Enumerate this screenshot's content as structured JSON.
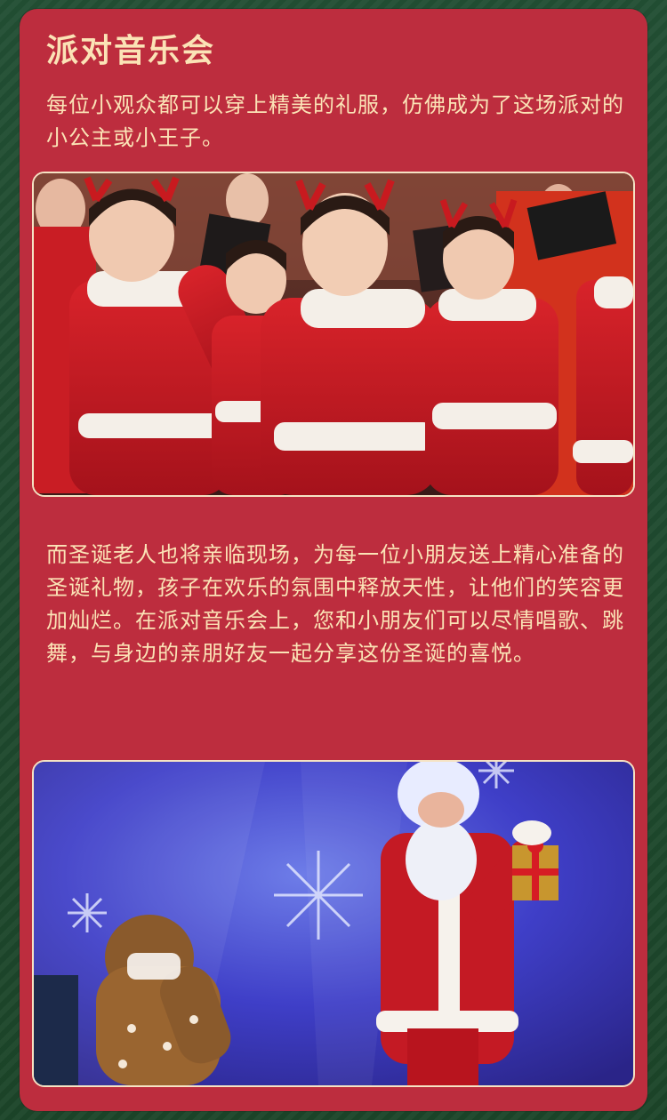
{
  "section": {
    "title": "派对音乐会",
    "paragraph1": "每位小观众都可以穿上精美的礼服，仿佛成为了这场派对的小公主或小王子。",
    "paragraph2": "而圣诞老人也将亲临现场，为每一位小朋友送上精心准备的圣诞礼物，孩子在欢乐的氛围中释放天性，让他们的笑容更加灿烂。在派对音乐会上，您和小朋友们可以尽情唱歌、跳舞，与身边的亲朋好友一起分享这份圣诞的喜悦。"
  },
  "images": {
    "photo1": "children-in-santa-costumes-choir-photo",
    "photo2": "santa-with-gift-and-reindeer-on-stage-photo"
  },
  "colors": {
    "background": "#1f4a30",
    "card": "#bd2d3e",
    "text": "#fbe3b6",
    "photo_border": "#f5e3c4"
  }
}
